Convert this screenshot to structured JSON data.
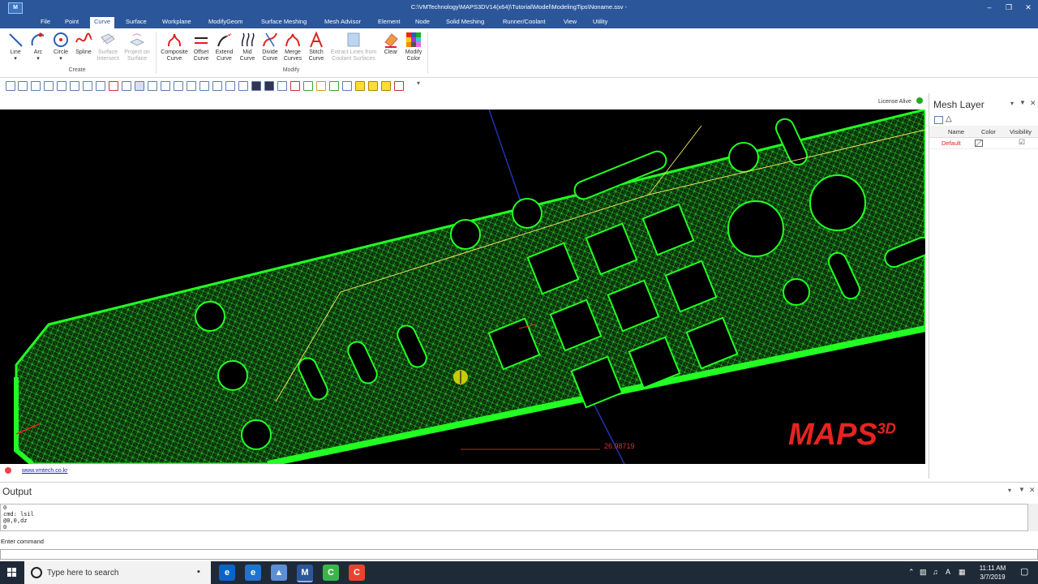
{
  "window": {
    "title": "C:\\VMTechnology\\MAPS3DV14(x64)\\Tutorial\\Model\\ModelingTips\\Noname.ssv -",
    "app_icon_label": "M",
    "controls": [
      "–",
      "❐",
      "✕"
    ]
  },
  "menu": {
    "tabs": [
      "File",
      "Point",
      "Curve",
      "Surface",
      "Workplane",
      "ModifyGeom",
      "Surface Meshing",
      "Mesh Advisor",
      "Element",
      "Node",
      "Solid Meshing",
      "Runner/Coolant",
      "View",
      "Utility"
    ],
    "active": "Curve"
  },
  "ribbon": {
    "create_group": "Create",
    "modify_group": "Modify",
    "create_buttons": [
      {
        "l1": "Line",
        "l2": ""
      },
      {
        "l1": "Arc",
        "l2": ""
      },
      {
        "l1": "Circle",
        "l2": ""
      },
      {
        "l1": "Spline",
        "l2": ""
      },
      {
        "l1": "Surface",
        "l2": "Intersect"
      },
      {
        "l1": "Project on",
        "l2": "Surface"
      }
    ],
    "modify_buttons": [
      {
        "l1": "Composite",
        "l2": "Curve"
      },
      {
        "l1": "Offset",
        "l2": "Curve"
      },
      {
        "l1": "Extend",
        "l2": "Curve"
      },
      {
        "l1": "Mid",
        "l2": "Curve"
      },
      {
        "l1": "Divide",
        "l2": "Curve"
      },
      {
        "l1": "Merge",
        "l2": "Curves"
      },
      {
        "l1": "Stitch",
        "l2": "Curve"
      },
      {
        "l1": "Extract Lines from",
        "l2": "Coolant Surfaces"
      },
      {
        "l1": "Clear",
        "l2": ""
      },
      {
        "l1": "Modify",
        "l2": "Color"
      }
    ]
  },
  "status": {
    "license": "License Alive"
  },
  "viewport": {
    "logo": "MAPS",
    "logo_sup": "3D",
    "dimension_value": "26.98719"
  },
  "mesh_panel": {
    "title": "Mesh Layer",
    "columns": [
      "Name",
      "Color",
      "Visibility"
    ],
    "rows": [
      {
        "name": "Default",
        "color": "",
        "visible": "☑"
      }
    ]
  },
  "link": {
    "url": "www.vmtech.co.kr"
  },
  "output": {
    "title": "Output",
    "log": [
      "0",
      "cmd: lsil",
      "@0,0,dz",
      "0"
    ],
    "command_label": "Enter command",
    "command_value": ""
  },
  "taskbar": {
    "search_placeholder": "Type here to search",
    "time": "11:11 AM",
    "date": "3/7/2019",
    "lang": "A"
  },
  "colors": {
    "titlebar": "#2b579a",
    "mesh": "#22ff22",
    "viewport_bg": "#000000",
    "logo_red": "#e8231f"
  }
}
